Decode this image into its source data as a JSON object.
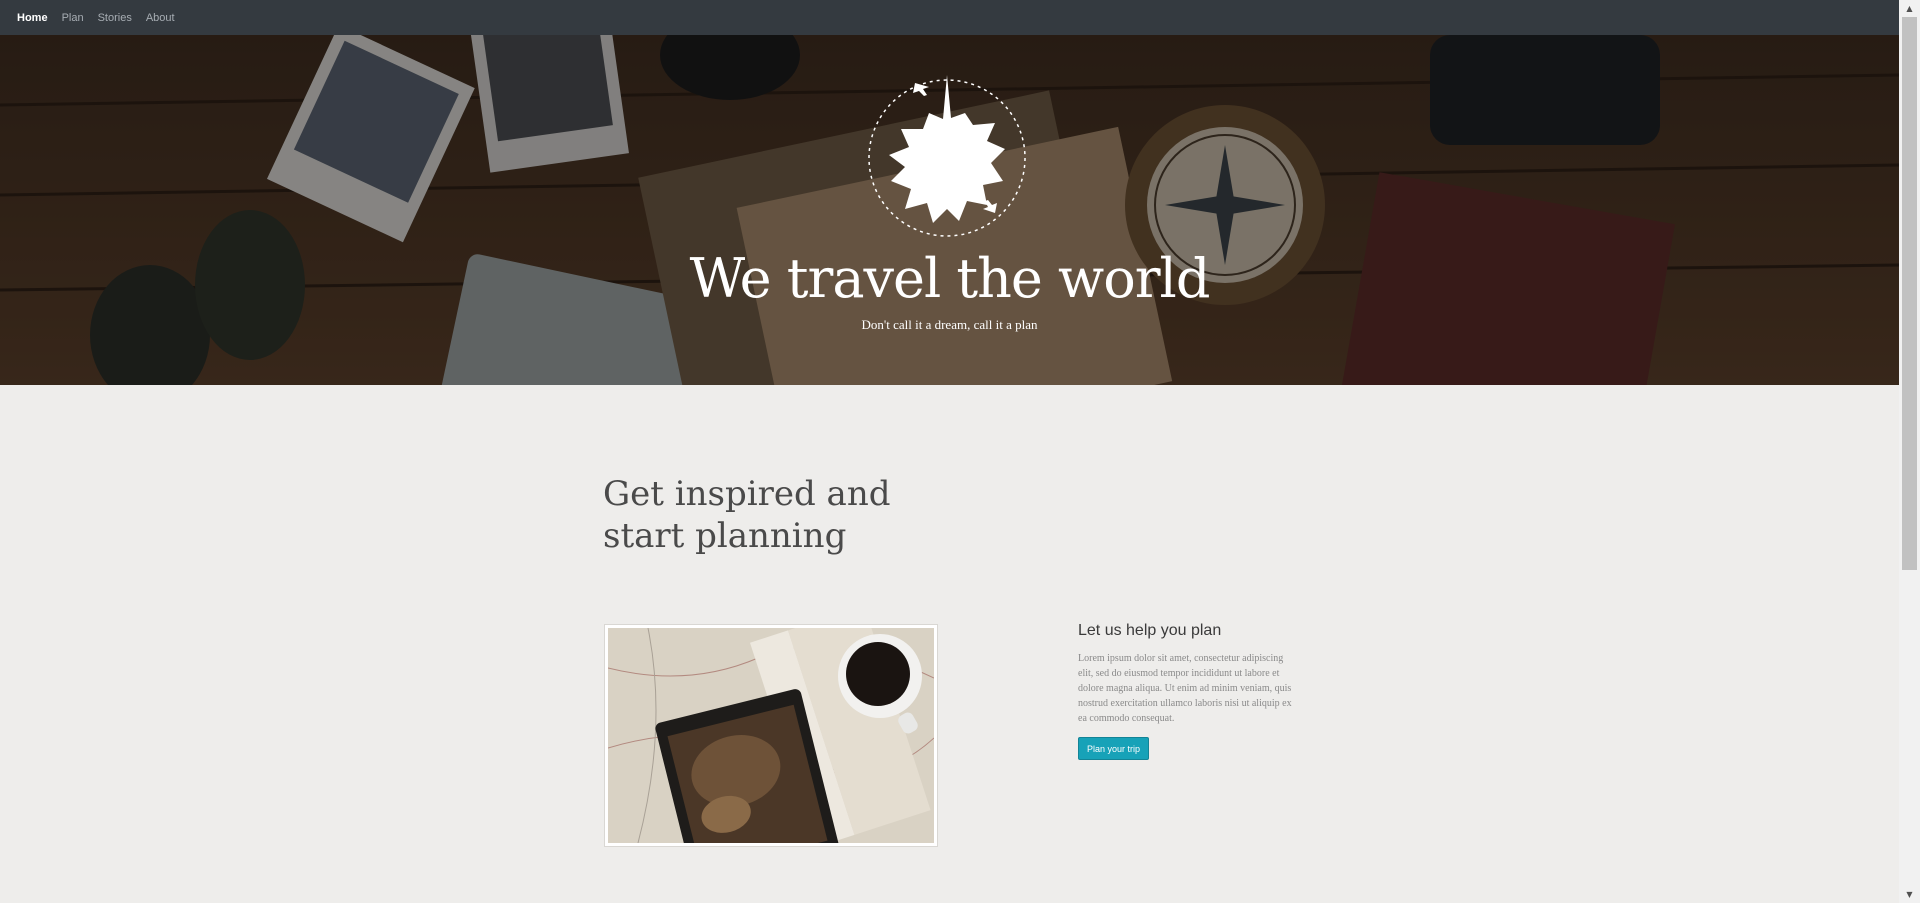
{
  "nav": {
    "items": [
      {
        "label": "Home",
        "active": true
      },
      {
        "label": "Plan",
        "active": false
      },
      {
        "label": "Stories",
        "active": false
      },
      {
        "label": "About",
        "active": false
      }
    ]
  },
  "hero": {
    "logo_icon": "globe-travel-icon",
    "title": "We travel the world",
    "subtitle": "Don't call it a dream, call it a plan"
  },
  "main": {
    "section_title": "Get inspired and start planning",
    "photo_icon": "map-notebook-coffee-photo",
    "plan_heading": "Let us help you plan",
    "plan_text": "Lorem ipsum dolor sit amet, consectetur adipiscing elit, sed do eiusmod tempor incididunt ut labore et dolore magna aliqua. Ut enim ad minim veniam, quis nostrud exercitation ullamco laboris nisi ut aliquip ex ea commodo consequat.",
    "plan_button": "Plan your trip"
  },
  "colors": {
    "navbar": "#343a40",
    "page_bg": "#eeedeb",
    "accent": "#17a2b8"
  }
}
